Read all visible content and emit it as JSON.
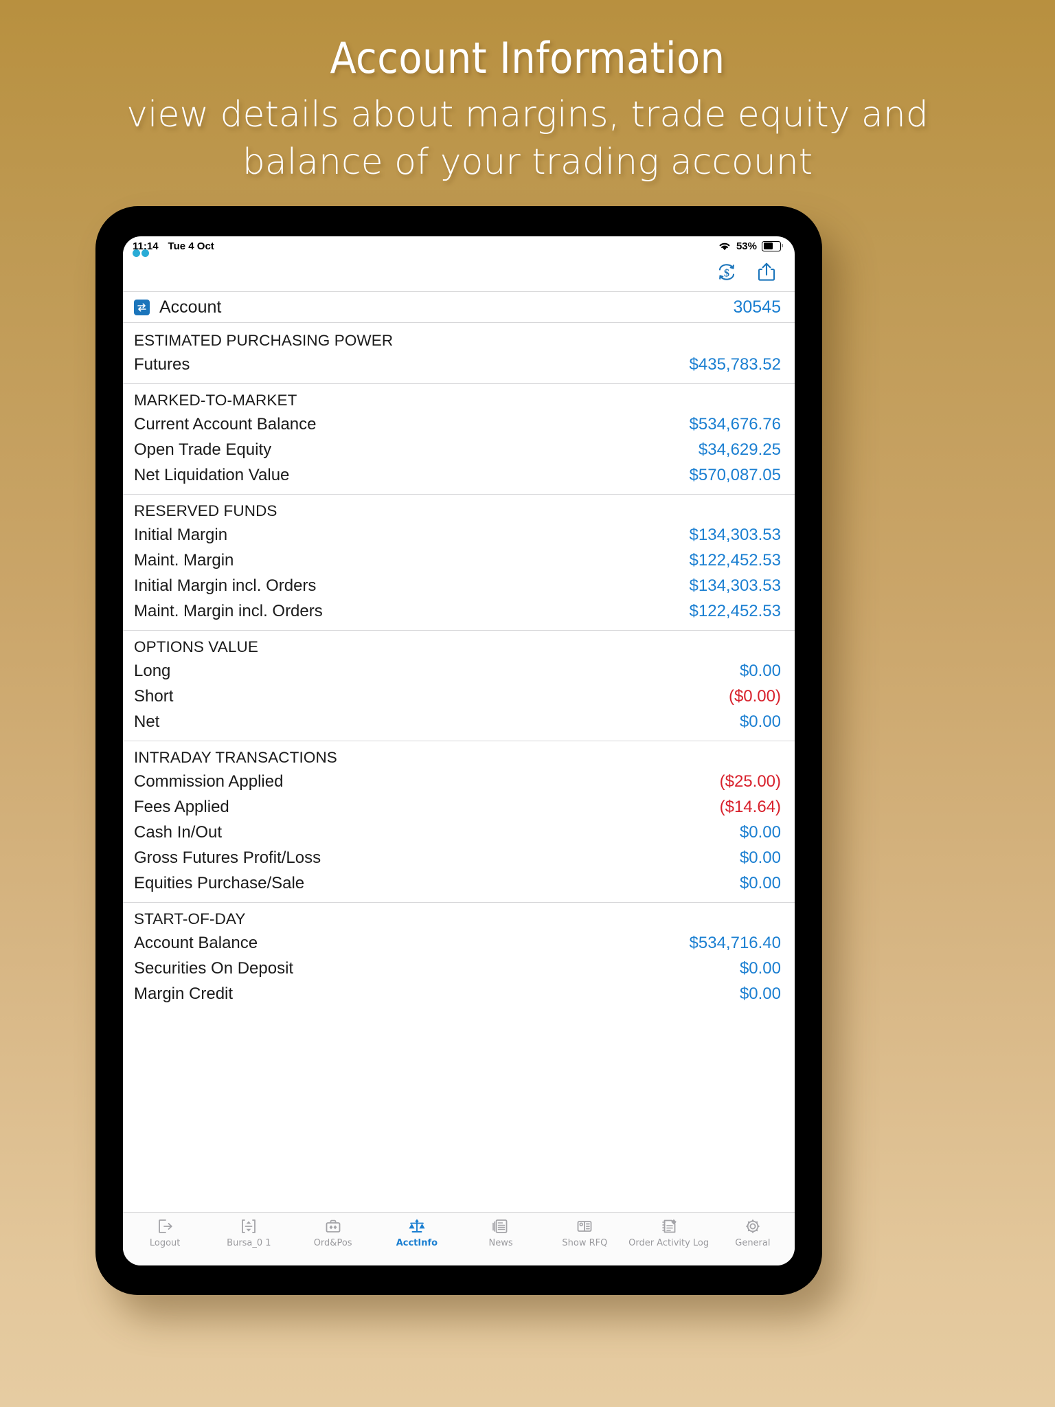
{
  "promo": {
    "title": "Account Information",
    "subtitle": "view details about margins, trade equity and balance of your trading account"
  },
  "status_bar": {
    "time": "11:14",
    "date": "Tue 4 Oct",
    "battery_percent": "53%",
    "wifi_icon": "wifi-icon",
    "battery_icon": "battery-icon"
  },
  "toolbar": {
    "refresh_currency_icon": "dollar-refresh-icon",
    "share_icon": "share-icon"
  },
  "account": {
    "swap_icon": "swap-arrows-icon",
    "label": "Account",
    "number": "30545"
  },
  "colors": {
    "value_positive": "#1b7fd1",
    "value_negative": "#d8212c",
    "accent": "#1b75bb",
    "background_top": "#b8903f",
    "background_bottom": "#e6cca2"
  },
  "sections": [
    {
      "title": "ESTIMATED PURCHASING POWER",
      "rows": [
        {
          "label": "Futures",
          "value": "$435,783.52",
          "tone": "blue"
        }
      ]
    },
    {
      "title": "MARKED-TO-MARKET",
      "rows": [
        {
          "label": "Current Account Balance",
          "value": "$534,676.76",
          "tone": "blue"
        },
        {
          "label": "Open Trade Equity",
          "value": "$34,629.25",
          "tone": "blue"
        },
        {
          "label": "Net Liquidation Value",
          "value": "$570,087.05",
          "tone": "blue"
        }
      ]
    },
    {
      "title": "RESERVED FUNDS",
      "rows": [
        {
          "label": "Initial Margin",
          "value": "$134,303.53",
          "tone": "blue"
        },
        {
          "label": "Maint. Margin",
          "value": "$122,452.53",
          "tone": "blue"
        },
        {
          "label": "Initial Margin incl. Orders",
          "value": "$134,303.53",
          "tone": "blue"
        },
        {
          "label": "Maint. Margin incl. Orders",
          "value": "$122,452.53",
          "tone": "blue"
        }
      ]
    },
    {
      "title": "OPTIONS VALUE",
      "rows": [
        {
          "label": "Long",
          "value": "$0.00",
          "tone": "blue"
        },
        {
          "label": "Short",
          "value": "($0.00)",
          "tone": "red"
        },
        {
          "label": "Net",
          "value": "$0.00",
          "tone": "blue"
        }
      ]
    },
    {
      "title": "INTRADAY TRANSACTIONS",
      "rows": [
        {
          "label": "Commission Applied",
          "value": "($25.00)",
          "tone": "red"
        },
        {
          "label": "Fees Applied",
          "value": "($14.64)",
          "tone": "red"
        },
        {
          "label": "Cash In/Out",
          "value": "$0.00",
          "tone": "blue"
        },
        {
          "label": "Gross Futures Profit/Loss",
          "value": "$0.00",
          "tone": "blue"
        },
        {
          "label": "Equities Purchase/Sale",
          "value": "$0.00",
          "tone": "blue"
        }
      ]
    },
    {
      "title": "START-OF-DAY",
      "rows": [
        {
          "label": "Account Balance",
          "value": "$534,716.40",
          "tone": "blue"
        },
        {
          "label": "Securities On Deposit",
          "value": "$0.00",
          "tone": "blue"
        },
        {
          "label": "Margin Credit",
          "value": "$0.00",
          "tone": "blue"
        }
      ]
    }
  ],
  "tabs": [
    {
      "label": "Logout",
      "icon": "logout-icon",
      "active": false
    },
    {
      "label": "Bursa_0 1",
      "icon": "quotes-icon",
      "active": false
    },
    {
      "label": "Ord&Pos",
      "icon": "briefcase-icon",
      "active": false
    },
    {
      "label": "AcctInfo",
      "icon": "scales-icon",
      "active": true
    },
    {
      "label": "News",
      "icon": "news-icon",
      "active": false
    },
    {
      "label": "Show RFQ",
      "icon": "rfq-icon",
      "active": false
    },
    {
      "label": "Order Activity Log",
      "icon": "activity-log-icon",
      "active": false
    },
    {
      "label": "General",
      "icon": "gear-icon",
      "active": false
    }
  ]
}
